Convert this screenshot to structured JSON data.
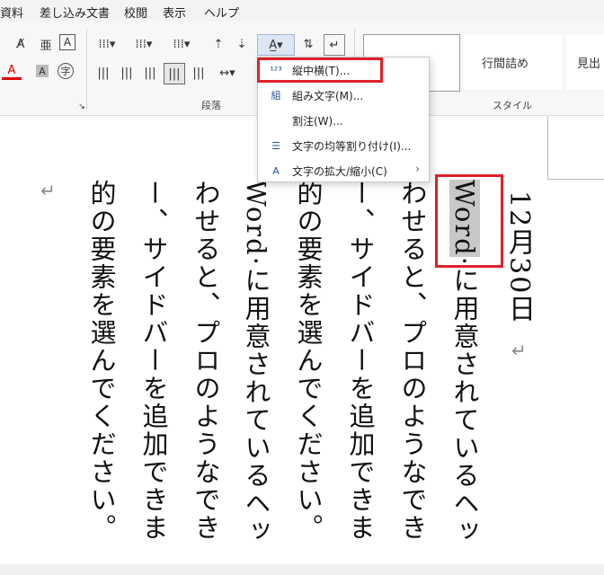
{
  "menu": [
    "資料",
    "差し込み文書",
    "校閲",
    "表示",
    "ヘルプ"
  ],
  "ribbon": {
    "group_paragraph": "段落",
    "group_style": "スタイル",
    "style_items": [
      "行間詰め",
      "見出"
    ]
  },
  "dropdown": {
    "items": [
      {
        "label": "縦中横(T)...",
        "icon": "tate-chu-yoko-icon",
        "highlighted": true
      },
      {
        "label": "組み文字(M)...",
        "icon": "kumimoji-icon"
      },
      {
        "label": "割注(W)...",
        "icon": ""
      },
      {
        "label": "文字の均等割り付け(I)...",
        "icon": "distribute-icon"
      },
      {
        "label": "文字の拡大/縮小(C)",
        "icon": "scale-icon",
        "submenu": true
      }
    ]
  },
  "document": {
    "date_col": "12月30日",
    "columns": [
      {
        "pre": "",
        "sel": "Word",
        "post": "·に用意されているヘッ"
      },
      {
        "pre": "わせると、プロのようなでき",
        "sel": "",
        "post": ""
      },
      {
        "pre": "ー、サイドバーを追加できま",
        "sel": "",
        "post": ""
      },
      {
        "pre": "的の要素を選んでください。",
        "sel": "",
        "post": ""
      },
      {
        "pre": "Word·に用意されているヘッ",
        "sel": "",
        "post": ""
      },
      {
        "pre": "わせると、プロのようなでき",
        "sel": "",
        "post": ""
      },
      {
        "pre": "ー、サイドバーを追加できま",
        "sel": "",
        "post": ""
      },
      {
        "pre": "的の要素を選んでください。",
        "sel": "",
        "post": ""
      }
    ],
    "para_mark": "↵"
  },
  "colors": {
    "accent": "#2b579a",
    "highlight_border": "#e0202a",
    "selection": "#c8c8c8"
  }
}
